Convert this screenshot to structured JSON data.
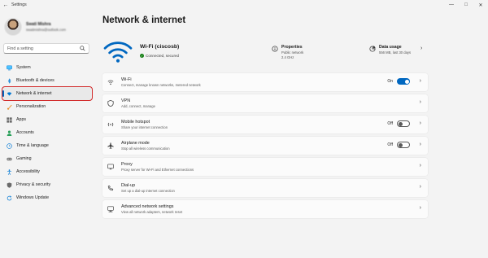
{
  "window": {
    "title": "Settings",
    "back_glyph": "←",
    "controls": [
      "—",
      "□",
      "✕"
    ]
  },
  "sidebar": {
    "profile": {
      "name": "Swati Mishra",
      "email": "swatimishra@outlook.com"
    },
    "search": {
      "placeholder": "Find a setting"
    },
    "items": [
      {
        "label": "System",
        "icon": "monitor-icon"
      },
      {
        "label": "Bluetooth & devices",
        "icon": "bluetooth-icon"
      },
      {
        "label": "Network & internet",
        "icon": "wifi-icon",
        "active": true
      },
      {
        "label": "Personalization",
        "icon": "brush-icon"
      },
      {
        "label": "Apps",
        "icon": "apps-icon"
      },
      {
        "label": "Accounts",
        "icon": "person-icon"
      },
      {
        "label": "Time & language",
        "icon": "globe-clock-icon"
      },
      {
        "label": "Gaming",
        "icon": "gamepad-icon"
      },
      {
        "label": "Accessibility",
        "icon": "accessibility-icon"
      },
      {
        "label": "Privacy & security",
        "icon": "shield-icon"
      },
      {
        "label": "Windows Update",
        "icon": "refresh-icon"
      }
    ]
  },
  "main": {
    "title": "Network & internet",
    "connection": {
      "name": "Wi-Fi (ciscosb)",
      "status": "Connected, secured",
      "properties": {
        "title": "Properties",
        "line1": "Public network",
        "line2": "2.4 GHz"
      },
      "data_usage": {
        "title": "Data usage",
        "line1": "556 MB, last 30 days"
      }
    },
    "cards": [
      {
        "title": "Wi-Fi",
        "subtitle": "Connect, manage known networks, metered network",
        "toggle": "On",
        "toggle_on": true,
        "icon": "wifi-icon"
      },
      {
        "title": "VPN",
        "subtitle": "Add, connect, manage",
        "icon": "vpn-shield-icon"
      },
      {
        "title": "Mobile hotspot",
        "subtitle": "Share your internet connection",
        "toggle": "Off",
        "toggle_on": false,
        "icon": "hotspot-icon"
      },
      {
        "title": "Airplane mode",
        "subtitle": "Stop all wireless communication",
        "toggle": "Off",
        "toggle_on": false,
        "icon": "airplane-icon"
      },
      {
        "title": "Proxy",
        "subtitle": "Proxy server for Wi-Fi and Ethernet connections",
        "icon": "proxy-icon"
      },
      {
        "title": "Dial-up",
        "subtitle": "Set up a dial-up internet connection",
        "icon": "dialup-icon"
      },
      {
        "title": "Advanced network settings",
        "subtitle": "View all network adapters, network reset",
        "icon": "monitor-network-icon"
      }
    ]
  },
  "colors": {
    "accent": "#0067c0",
    "highlight_box": "#d22a2a",
    "connected": "#107c10"
  }
}
